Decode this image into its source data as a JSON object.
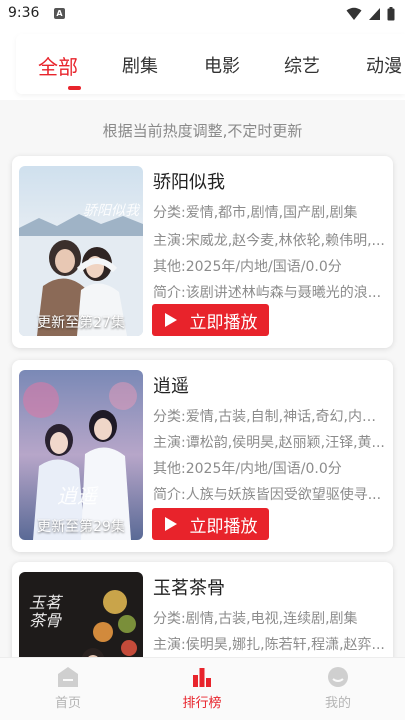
{
  "status_bar": {
    "time": "9:36",
    "app_icon_letter": "A"
  },
  "tabs": [
    {
      "label": "全部",
      "active": true
    },
    {
      "label": "剧集",
      "active": false
    },
    {
      "label": "电影",
      "active": false
    },
    {
      "label": "综艺",
      "active": false
    },
    {
      "label": "动漫",
      "active": false
    }
  ],
  "notice": "根据当前热度调整,不定时更新",
  "items": [
    {
      "title": "骄阳似我",
      "category": "分类:爱情,都市,剧情,国产剧,剧集",
      "cast": "主演:宋威龙,赵今麦,林依轮,赖伟明,...",
      "other": "其他:2025年/内地/国语/0.0分",
      "intro": "简介:该剧讲述林屿森与聂曦光的浪...",
      "update": "更新至第27集",
      "poster_art": "骄阳似我",
      "play_label": "立即播放"
    },
    {
      "title": "逍遥",
      "category": "分类:爱情,古装,自制,神话,奇幻,内地...",
      "cast": "主演:谭松韵,侯明昊,赵丽颖,汪铎,黄...",
      "other": "其他:2025年/内地/国语/0.0分",
      "intro": "简介:人族与妖族皆因受欲望驱使寻...",
      "update": "更新至第29集",
      "poster_art": "逍遥",
      "play_label": "立即播放"
    },
    {
      "title": "玉茗茶骨",
      "category": "分类:剧情,古装,电视,连续剧,剧集",
      "cast": "主演:侯明昊,娜扎,陈若轩,程潇,赵弈...",
      "poster_art": "玉茗茶骨"
    }
  ],
  "bottom_nav": [
    {
      "label": "首页",
      "icon": "home-icon",
      "active": false
    },
    {
      "label": "排行榜",
      "icon": "ranking-icon",
      "active": true
    },
    {
      "label": "我的",
      "icon": "profile-icon",
      "active": false
    }
  ],
  "colors": {
    "accent": "#e8242c",
    "muted_text": "#8c8c8c",
    "background": "#f7f7f7"
  }
}
